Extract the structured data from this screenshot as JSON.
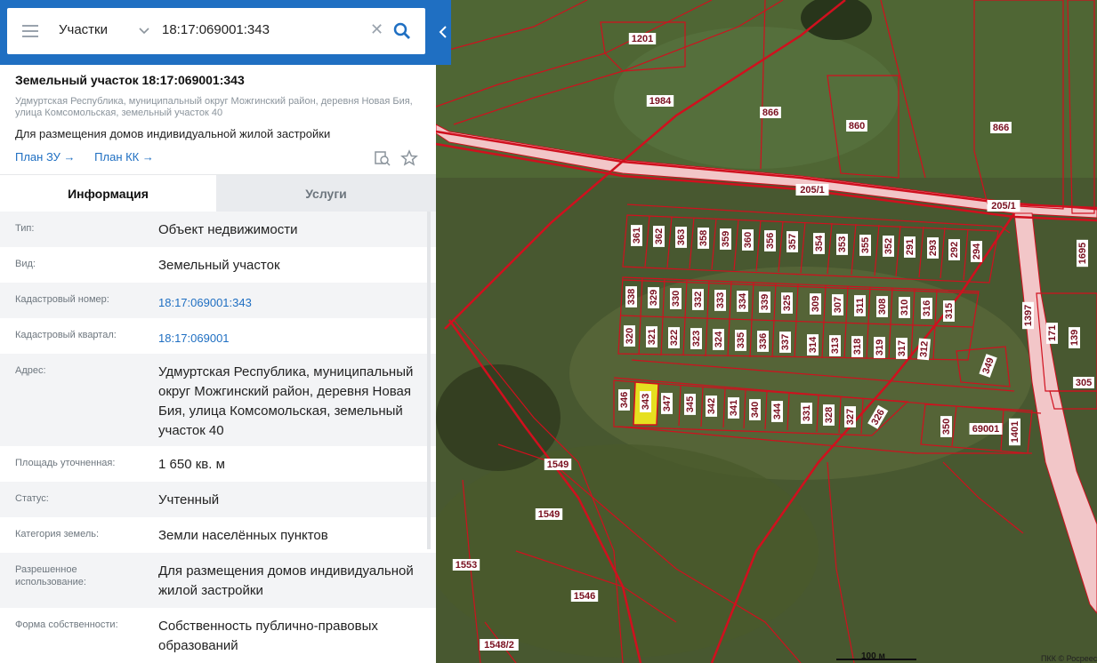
{
  "search": {
    "layer": "Участки",
    "query": "18:17:069001:343",
    "clear_icon": "close-icon",
    "search_icon": "search-icon"
  },
  "parcel": {
    "title": "Земельный участок 18:17:069001:343",
    "address_line": "Удмуртская Республика, муниципальный округ Можгинский район, деревня Новая Бия, улица Комсомольская, земельный участок 40",
    "use": "Для размещения домов индивидуальной жилой застройки",
    "link_plan_zu": "План ЗУ →",
    "link_plan_kk": "План КК →"
  },
  "tabs": {
    "info": "Информация",
    "services": "Услуги"
  },
  "info_rows": [
    {
      "label": "Тип:",
      "value": "Объект недвижимости",
      "link": false
    },
    {
      "label": "Вид:",
      "value": "Земельный участок",
      "link": false
    },
    {
      "label": "Кадастровый номер:",
      "value": "18:17:069001:343",
      "link": true
    },
    {
      "label": "Кадастровый квартал:",
      "value": "18:17:069001",
      "link": true
    },
    {
      "label": "Адрес:",
      "value": "Удмуртская Республика, муниципальный округ Можгинский район, деревня Новая Бия, улица Комсомольская, земельный участок 40",
      "link": false
    },
    {
      "label": "Площадь уточненная:",
      "value": "1 650 кв. м",
      "link": false
    },
    {
      "label": "Статус:",
      "value": "Учтенный",
      "link": false
    },
    {
      "label": "Категория земель:",
      "value": "Земли населённых пунктов",
      "link": false
    },
    {
      "label": "Разрешенное использование:",
      "value": "Для размещения домов индивидуальной жилой застройки",
      "link": false
    },
    {
      "label": "Форма собственности:",
      "value": "Собственность публично-правовых образований",
      "link": false
    }
  ],
  "map": {
    "scale": "100 м",
    "copyright": "ПКК © Росреестр",
    "selected_parcel": "343",
    "colors": {
      "boundary": "#d0101e",
      "road": "#f2c6c8",
      "selected": "#e6e020"
    },
    "labels": [
      "1201",
      "1984",
      "866",
      "860",
      "866",
      "205/1",
      "205/1",
      "361",
      "362",
      "363",
      "358",
      "359",
      "360",
      "356",
      "357",
      "354",
      "353",
      "355",
      "352",
      "291",
      "293",
      "292",
      "294",
      "338",
      "329",
      "330",
      "332",
      "333",
      "334",
      "339",
      "325",
      "309",
      "307",
      "311",
      "308",
      "310",
      "316",
      "315",
      "320",
      "321",
      "322",
      "323",
      "324",
      "335",
      "336",
      "337",
      "314",
      "313",
      "318",
      "319",
      "317",
      "312",
      "349",
      "346",
      "343",
      "347",
      "345",
      "342",
      "341",
      "340",
      "344",
      "331",
      "328",
      "327",
      "326",
      "350",
      "69001",
      "1401",
      "1397",
      "171",
      "139",
      "305",
      "1549",
      "1549",
      "1553",
      "1546",
      "1548/2",
      "1695"
    ]
  }
}
